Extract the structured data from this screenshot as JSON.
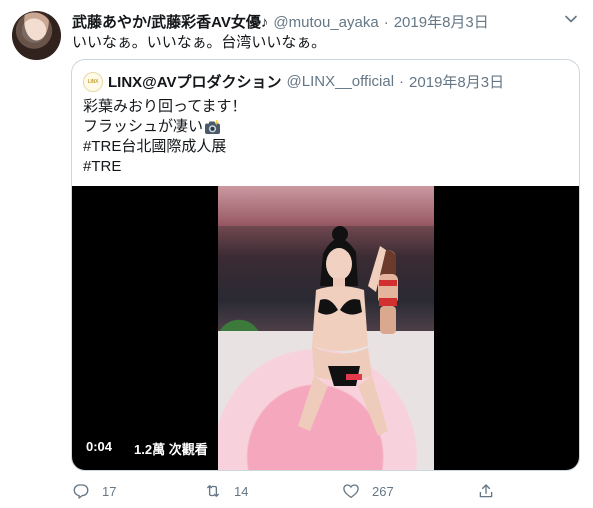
{
  "tweet": {
    "author_name": "武藤あやか/武藤彩香AV女優♪",
    "handle": "@mutou_ayaka",
    "separator": "·",
    "date": "2019年8月3日",
    "text": "いいなぁ。いいなぁ。台湾いいなぁ。"
  },
  "quoted": {
    "author_name": "LINX@AVプロダクション",
    "handle": "@LINX__official",
    "separator": "·",
    "date": "2019年8月3日",
    "avatar_text": "LINX",
    "lines": [
      "彩葉みおり回ってます！",
      "フラッシュが凄い",
      "#TRE台北國際成人展",
      "#TRE"
    ],
    "emoji_icon": "camera-flash-icon",
    "video": {
      "duration": "0:04",
      "views": "1.2萬 次觀看"
    }
  },
  "actions": {
    "reply_count": "17",
    "retweet_count": "14",
    "like_count": "267"
  },
  "colors": {
    "text": "#14171a",
    "secondary": "#657786",
    "border": "#ccd6dd"
  }
}
